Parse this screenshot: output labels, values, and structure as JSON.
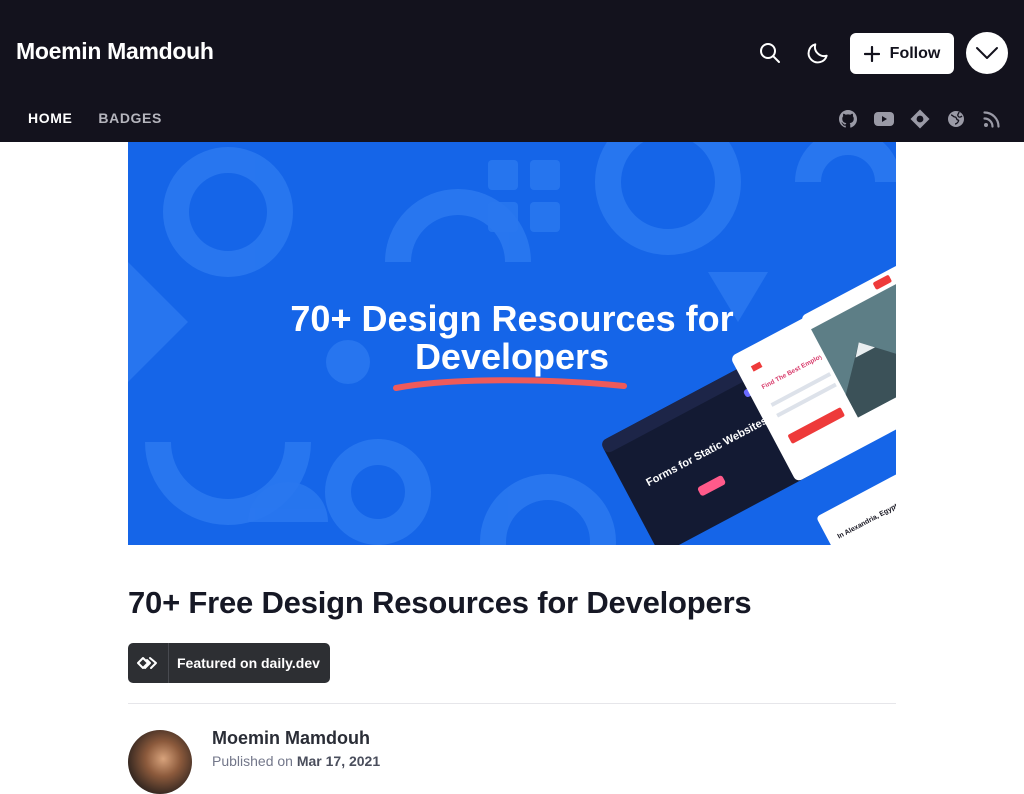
{
  "header": {
    "brand": "Moemin Mamdouh",
    "follow_label": "Follow",
    "icons": [
      "search-icon",
      "moon-icon",
      "chevron-down-icon"
    ]
  },
  "nav": {
    "items": [
      {
        "label": "HOME",
        "active": true
      },
      {
        "label": "BADGES",
        "active": false
      }
    ],
    "social": [
      "github-icon",
      "youtube-icon",
      "hashnode-icon",
      "globe-icon",
      "rss-icon"
    ]
  },
  "cover": {
    "title_line1": "70+ Design Resources for",
    "title_line2": "Developers",
    "mockup_text_1": "Find The Best Employee Program With Your Current Qualifications",
    "mockup_text_2": "Forms for Static Websites",
    "mockup_text_3": "In Alexandria, Egypt. I design and make things that people love"
  },
  "post": {
    "title": "70+ Free Design Resources for Developers",
    "badge_label": "Featured on daily.dev",
    "author": "Moemin Mamdouh",
    "published_prefix": "Published on",
    "published_date": "Mar 17, 2021"
  },
  "colors": {
    "header_bg": "#13121d",
    "cover_bg": "#1565e8",
    "underline": "#ee5a5a",
    "badge_bg": "#2d2f33"
  }
}
